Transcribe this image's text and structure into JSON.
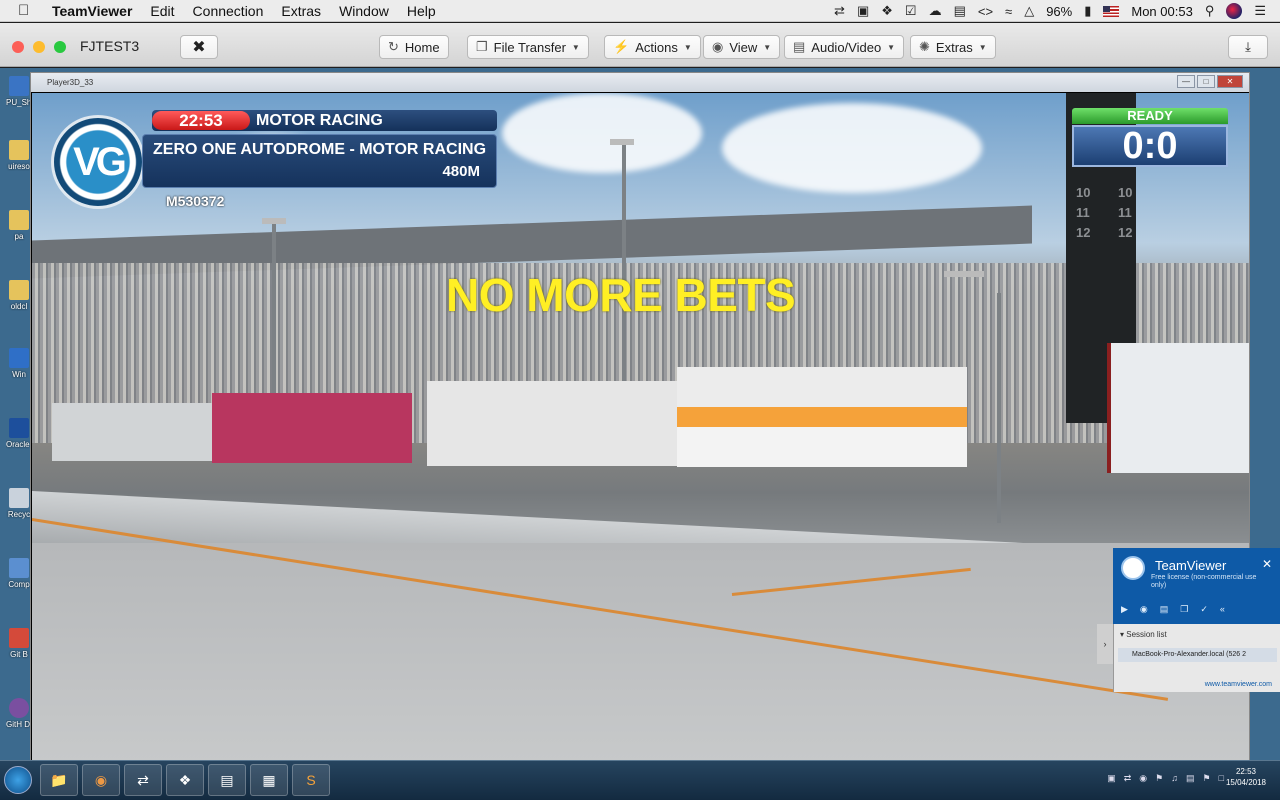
{
  "mac_menubar": {
    "app_name": "TeamViewer",
    "menus": [
      "Edit",
      "Connection",
      "Extras",
      "Window",
      "Help"
    ],
    "battery": "96%",
    "clock": "Mon 00:53"
  },
  "tv_toolbar": {
    "title": "FJTEST3",
    "buttons": {
      "home": "Home",
      "file_transfer": "File Transfer",
      "actions": "Actions",
      "view": "View",
      "audio_video": "Audio/Video",
      "extras": "Extras"
    }
  },
  "desktop_icons": [
    "PU_Sh Short",
    "uireso",
    "pa",
    "oldcl",
    "Win",
    "Oracle Virtu",
    "Recyc",
    "Comp",
    "Git B",
    "GitH Desk"
  ],
  "game_window": {
    "title": "Player3D_33",
    "hud": {
      "timer": "22:53",
      "category": "MOTOR RACING",
      "event_name": "ZERO ONE AUTODROME - MOTOR RACING",
      "distance": "480M",
      "event_id": "M530372",
      "logo_text": "VG",
      "status": "READY",
      "score": "0:0",
      "announcement": "NO MORE BETS",
      "board_numbers": [
        "10",
        "11",
        "12"
      ]
    }
  },
  "tv_popup": {
    "brand": "TeamViewer",
    "license": "Free license (non-commercial use only)",
    "session_header": "Session list",
    "session_item": "MacBook-Pro-Alexander.local (526 2",
    "link": "www.teamviewer.com"
  },
  "win_taskbar": {
    "clock_time": "22:53",
    "clock_date": "15/04/2018"
  }
}
